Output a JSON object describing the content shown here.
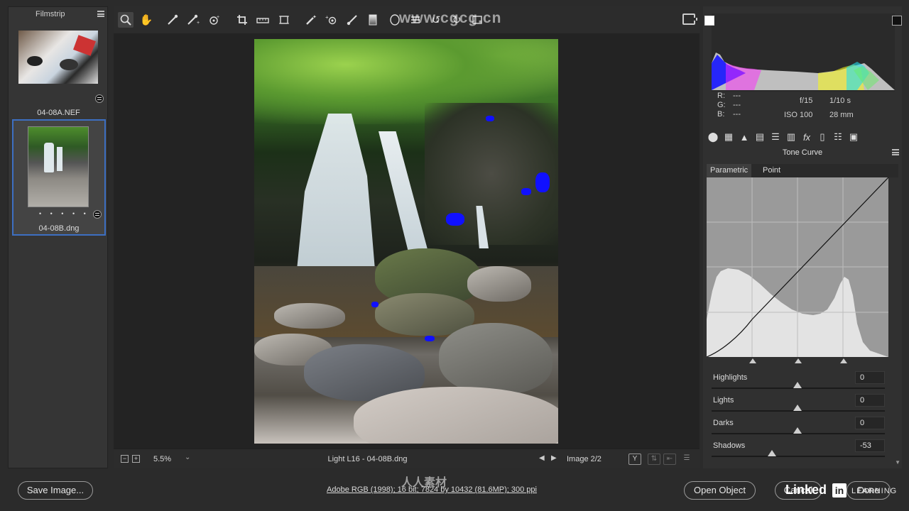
{
  "filmstrip": {
    "title": "Filmstrip",
    "thumbnails": [
      {
        "name": "04-08A.NEF",
        "selected": false
      },
      {
        "name": "04-08B.dng",
        "selected": true,
        "rating": "• • • • •"
      }
    ]
  },
  "toolbar": {
    "tools": [
      "zoom-icon",
      "hand-icon",
      "white-balance-picker-icon",
      "color-sampler-icon",
      "targeted-adjustment-icon",
      "crop-icon",
      "straighten-icon",
      "transform-icon",
      "spot-removal-icon",
      "red-eye-icon",
      "brush-icon",
      "graduated-filter-icon",
      "radial-filter-icon",
      "presets-icon",
      "rotate-left-icon",
      "rotate-right-icon"
    ],
    "active_tool": "zoom-icon"
  },
  "statusbar": {
    "zoom": "5.5%",
    "file_title": "Light L16  -  04-08B.dng",
    "image_count": "Image 2/2",
    "before_after_label": "Y"
  },
  "info": {
    "r_label": "R:",
    "r_value": "---",
    "g_label": "G:",
    "g_value": "---",
    "b_label": "B:",
    "b_value": "---",
    "aperture": "f/15",
    "shutter": "1/10 s",
    "iso": "ISO 100",
    "focal_length": "28 mm"
  },
  "panel": {
    "title": "Tone Curve",
    "tabs": [
      "Parametric",
      "Point"
    ],
    "active_tab": "Parametric",
    "sliders": [
      {
        "label": "Highlights",
        "value": "0"
      },
      {
        "label": "Lights",
        "value": "0"
      },
      {
        "label": "Darks",
        "value": "0"
      },
      {
        "label": "Shadows",
        "value": "-53"
      }
    ]
  },
  "bottombar": {
    "save_label": "Save Image...",
    "workflow": "Adobe RGB (1998); 16 bit; 7824 by 10432 (81.6MP); 300 ppi",
    "open_label": "Open Object",
    "cancel_label": "Cancel",
    "done_label": "Done"
  },
  "watermarks": {
    "brand_text": "Linked",
    "brand_box": "in",
    "brand_suffix": "LEARNING",
    "site": "www.cgcg.cn",
    "bottom": "人人素材"
  },
  "colors": {
    "accent": "#3d6fc2",
    "clipping": "#1010ff"
  }
}
